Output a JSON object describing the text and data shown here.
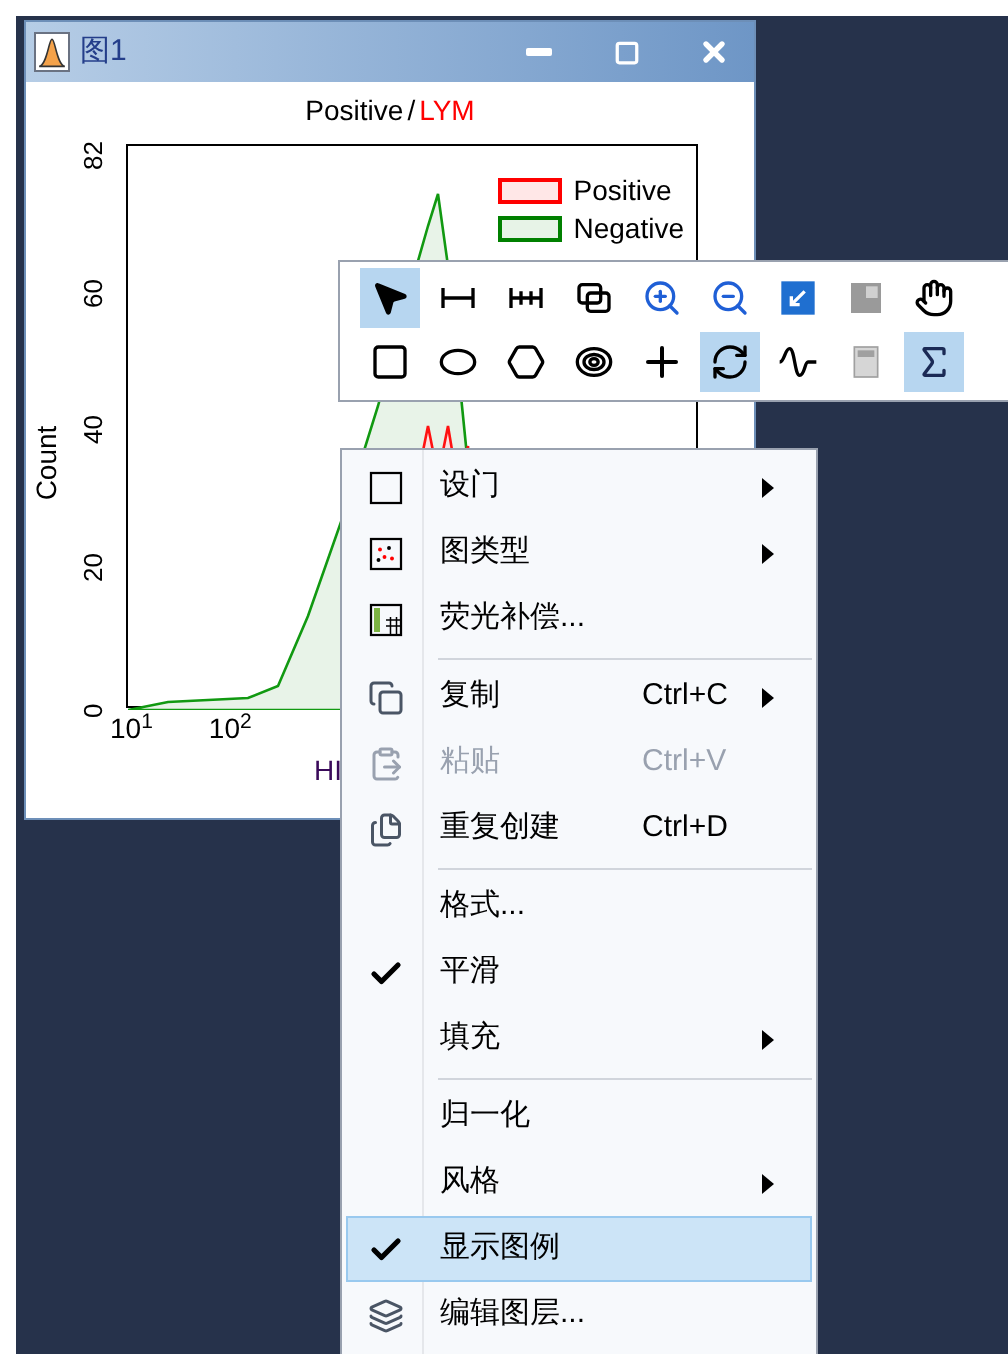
{
  "window": {
    "title": "图1",
    "chart_title_parts": [
      "Positive",
      "/",
      "LYM"
    ],
    "legend": [
      {
        "label": "Positive",
        "color": "#ff0000"
      },
      {
        "label": "Negative",
        "color": "#008000"
      }
    ],
    "y_axis_label": "Count",
    "y_ticks": [
      "82",
      "60",
      "40",
      "20",
      "0"
    ],
    "x_ticks": [
      "10$^{1}$",
      "10$^{2}$"
    ],
    "x_axis_label": "HI"
  },
  "toolbar": {
    "rows": [
      [
        {
          "selected": true
        },
        {
          "selected": false
        },
        {
          "selected": false
        },
        {
          "selected": false
        },
        {
          "selected": false
        },
        {
          "selected": false
        },
        {
          "selected": false
        },
        {
          "selected": false
        },
        {
          "selected": false
        }
      ],
      [
        {
          "selected": false
        },
        {
          "selected": false
        },
        {
          "selected": false
        },
        {
          "selected": false
        },
        {
          "selected": false
        },
        {
          "selected": true
        },
        {
          "selected": false
        },
        {
          "selected": false
        },
        {
          "selected": true
        }
      ]
    ]
  },
  "context_menu": [
    {
      "kind": "item",
      "label": "设门",
      "submenu": true,
      "checked": false,
      "disabled": false,
      "selected": false
    },
    {
      "kind": "item",
      "label": "图类型",
      "submenu": true,
      "checked": false,
      "disabled": false,
      "selected": false
    },
    {
      "kind": "item",
      "label": "荧光补偿...",
      "submenu": false,
      "checked": false,
      "disabled": false,
      "selected": false
    },
    {
      "kind": "separator"
    },
    {
      "kind": "item",
      "label": "复制",
      "shortcut": "Ctrl+C",
      "submenu": true,
      "checked": false,
      "disabled": false,
      "selected": false
    },
    {
      "kind": "item",
      "label": "粘贴",
      "shortcut": "Ctrl+V",
      "submenu": false,
      "checked": false,
      "disabled": true,
      "selected": false
    },
    {
      "kind": "item",
      "label": "重复创建",
      "shortcut": "Ctrl+D",
      "submenu": false,
      "checked": false,
      "disabled": false,
      "selected": false
    },
    {
      "kind": "separator"
    },
    {
      "kind": "item",
      "label": "格式...",
      "submenu": false,
      "checked": false,
      "disabled": false,
      "selected": false
    },
    {
      "kind": "item",
      "label": "平滑",
      "submenu": false,
      "checked": true,
      "disabled": false,
      "selected": false
    },
    {
      "kind": "item",
      "label": "填充",
      "submenu": true,
      "checked": false,
      "disabled": false,
      "selected": false
    },
    {
      "kind": "separator"
    },
    {
      "kind": "item",
      "label": "归一化",
      "submenu": false,
      "checked": false,
      "disabled": false,
      "selected": false
    },
    {
      "kind": "item",
      "label": "风格",
      "submenu": true,
      "checked": false,
      "disabled": false,
      "selected": false
    },
    {
      "kind": "item",
      "label": "显示图例",
      "submenu": false,
      "checked": true,
      "disabled": false,
      "selected": true
    },
    {
      "kind": "item",
      "label": "编辑图层...",
      "submenu": false,
      "checked": false,
      "disabled": false,
      "selected": false
    }
  ]
}
